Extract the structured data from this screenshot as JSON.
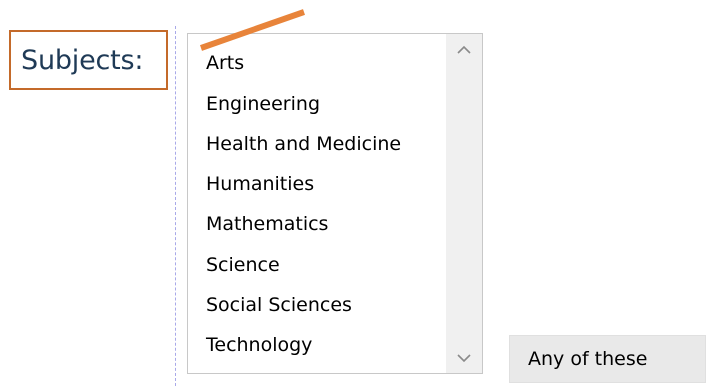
{
  "form": {
    "label": "Subjects:"
  },
  "subjects_list": {
    "items": [
      "Arts",
      "Engineering",
      "Health and Medicine",
      "Humanities",
      "Mathematics",
      "Science",
      "Social Sciences",
      "Technology"
    ],
    "scroll_up_icon": "chevron-up-icon",
    "scroll_down_icon": "chevron-down-icon"
  },
  "match_mode": {
    "selected": "Any of these"
  },
  "colors": {
    "label_border": "#c46a2a",
    "label_text": "#1f3a56",
    "annotation": "#e8843a",
    "guide_line": "#a9a9e8",
    "scrollbar": "#f0f0f0",
    "select_bg": "#e9e9e9"
  }
}
